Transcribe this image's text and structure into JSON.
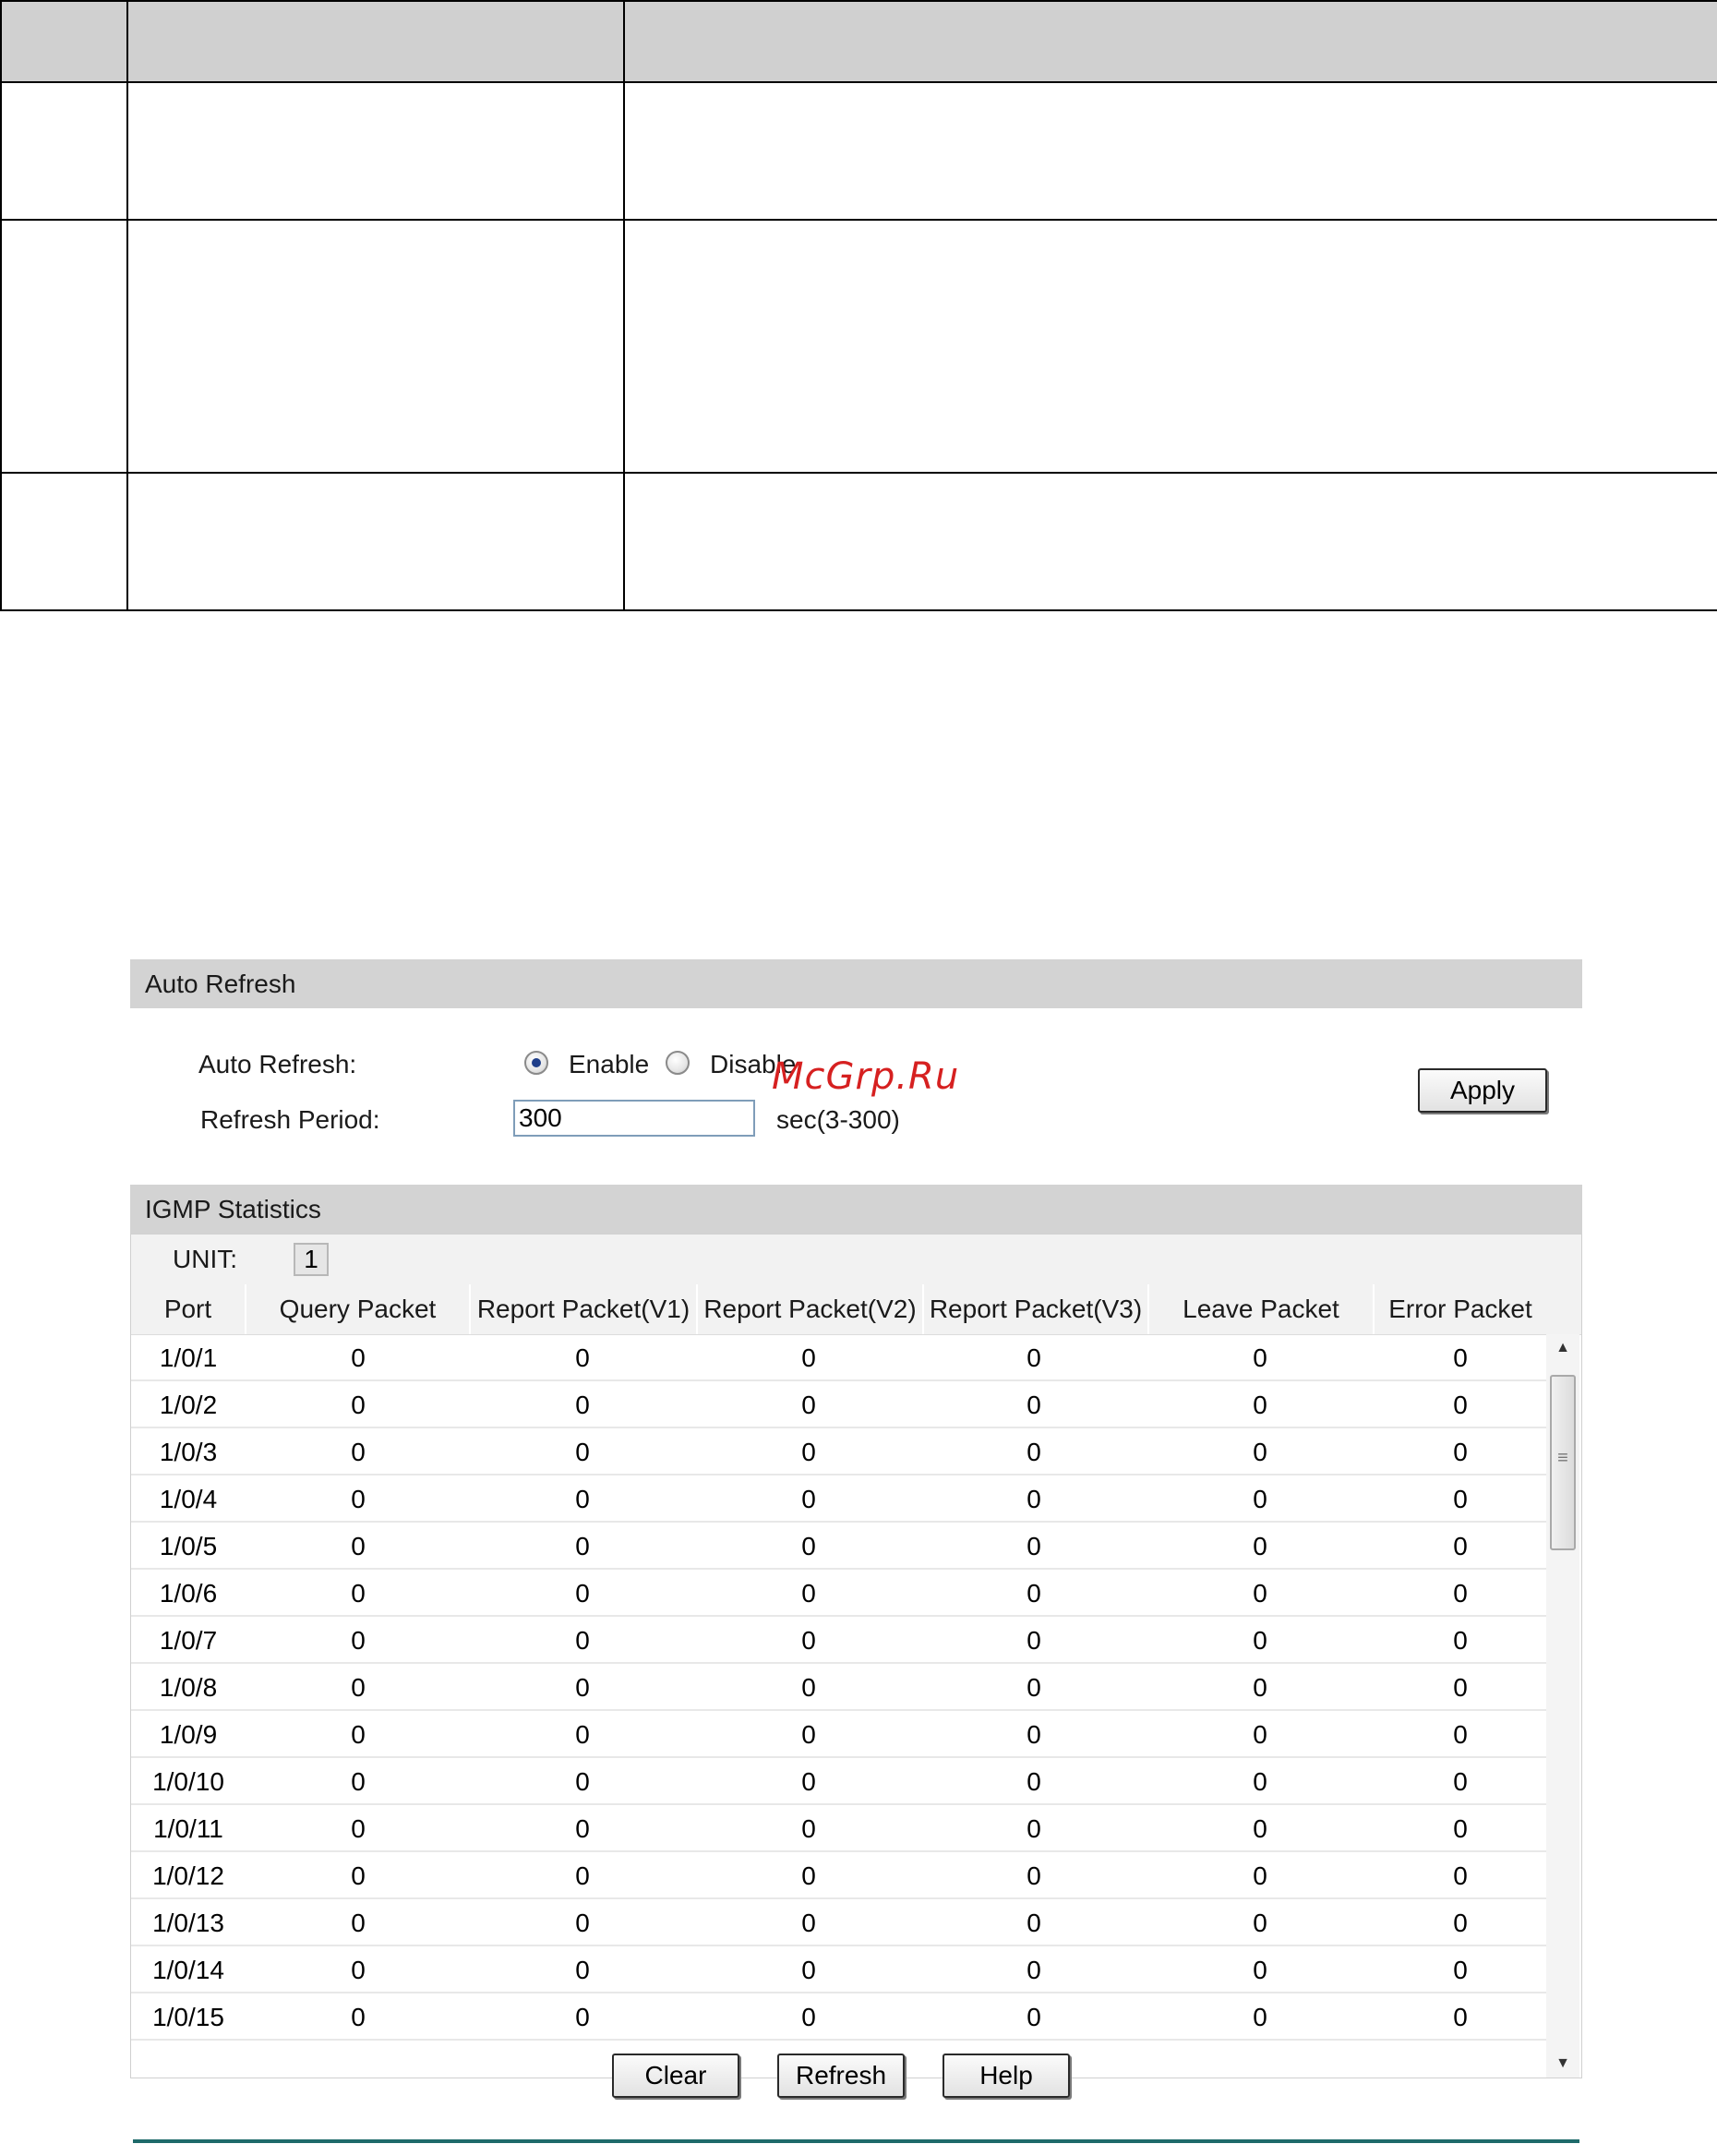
{
  "auto_refresh_section": {
    "title": "Auto Refresh",
    "auto_refresh_label": "Auto Refresh:",
    "enable_label": "Enable",
    "disable_label": "Disable",
    "selected": "Enable",
    "refresh_period_label": "Refresh Period:",
    "refresh_period_value": "300",
    "refresh_period_hint": "sec(3-300)",
    "apply_label": "Apply"
  },
  "stats_section": {
    "title": "IGMP Statistics",
    "unit_label": "UNIT:",
    "unit_value": "1",
    "columns": [
      "Port",
      "Query Packet",
      "Report Packet(V1)",
      "Report Packet(V2)",
      "Report Packet(V3)",
      "Leave Packet",
      "Error Packet"
    ],
    "rows": [
      [
        "1/0/1",
        "0",
        "0",
        "0",
        "0",
        "0",
        "0"
      ],
      [
        "1/0/2",
        "0",
        "0",
        "0",
        "0",
        "0",
        "0"
      ],
      [
        "1/0/3",
        "0",
        "0",
        "0",
        "0",
        "0",
        "0"
      ],
      [
        "1/0/4",
        "0",
        "0",
        "0",
        "0",
        "0",
        "0"
      ],
      [
        "1/0/5",
        "0",
        "0",
        "0",
        "0",
        "0",
        "0"
      ],
      [
        "1/0/6",
        "0",
        "0",
        "0",
        "0",
        "0",
        "0"
      ],
      [
        "1/0/7",
        "0",
        "0",
        "0",
        "0",
        "0",
        "0"
      ],
      [
        "1/0/8",
        "0",
        "0",
        "0",
        "0",
        "0",
        "0"
      ],
      [
        "1/0/9",
        "0",
        "0",
        "0",
        "0",
        "0",
        "0"
      ],
      [
        "1/0/10",
        "0",
        "0",
        "0",
        "0",
        "0",
        "0"
      ],
      [
        "1/0/11",
        "0",
        "0",
        "0",
        "0",
        "0",
        "0"
      ],
      [
        "1/0/12",
        "0",
        "0",
        "0",
        "0",
        "0",
        "0"
      ],
      [
        "1/0/13",
        "0",
        "0",
        "0",
        "0",
        "0",
        "0"
      ],
      [
        "1/0/14",
        "0",
        "0",
        "0",
        "0",
        "0",
        "0"
      ],
      [
        "1/0/15",
        "0",
        "0",
        "0",
        "0",
        "0",
        "0"
      ]
    ]
  },
  "buttons": {
    "clear": "Clear",
    "refresh": "Refresh",
    "help": "Help"
  },
  "watermark": "McGrp.Ru",
  "colors": {
    "section_header_bg": "#d3d3d3",
    "watermark": "#d62020",
    "rule": "#1e6a6a"
  },
  "icons": {
    "scroll_up": "scroll-up-arrow-icon",
    "scroll_down": "scroll-down-arrow-icon",
    "scroll_grip": "scroll-grip-icon"
  }
}
